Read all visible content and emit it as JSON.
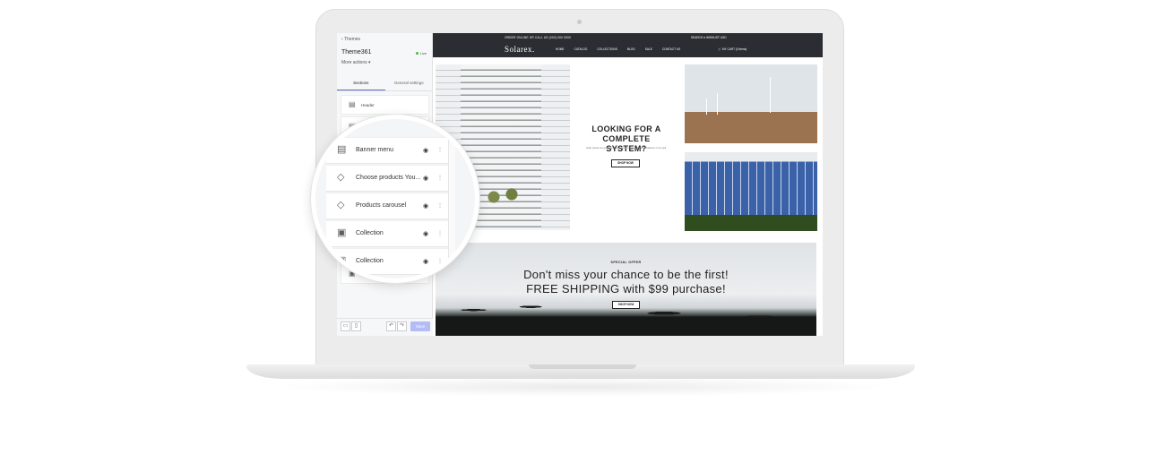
{
  "sidebar": {
    "back_label": "Themes",
    "theme_name": "Theme361",
    "live_label": "Live",
    "more_actions": "More actions",
    "tabs": [
      {
        "label": "Sections"
      },
      {
        "label": "General settings"
      }
    ],
    "sections": [
      {
        "label": "Header"
      }
    ],
    "save_label": "Save"
  },
  "magnified_sections": [
    {
      "label": "Banner menu",
      "icon": "banner-icon"
    },
    {
      "label": "Choose products You...",
      "icon": "tag-icon"
    },
    {
      "label": "Products carousel",
      "icon": "tag-icon"
    },
    {
      "label": "Collection",
      "icon": "collection-icon"
    },
    {
      "label": "Collection",
      "icon": "collection-icon"
    }
  ],
  "store": {
    "announcement": "ORDER ONLINE OR CALL US (000) 000 0000",
    "top_links": "SEARCH   ♥ WISHLIST   USD",
    "logo": "Solarex.",
    "nav": [
      "HOME",
      "CATALOG",
      "COLLECTIONS",
      "BLOG",
      "SALE",
      "CONTACT US"
    ],
    "cart": "MY CART (0 items)",
    "promo_title": "LOOKING FOR A COMPLETE SYSTEM?",
    "promo_text": "Solar panels are great, but they need to connect, either to batteries or the grid.",
    "shop_now": "SHOP NOW",
    "banner_kicker": "SPECIAL OFFER",
    "banner_line1": "Don't miss your chance to be the first!",
    "banner_line2": "FREE SHIPPING with $99 purchase!",
    "banner_cta": "SHOP NOW"
  },
  "colors": {
    "accent": "#5c6ac4",
    "live": "#50b83c",
    "save_disabled": "#b3bcf5",
    "store_bar": "#2b2d33"
  }
}
